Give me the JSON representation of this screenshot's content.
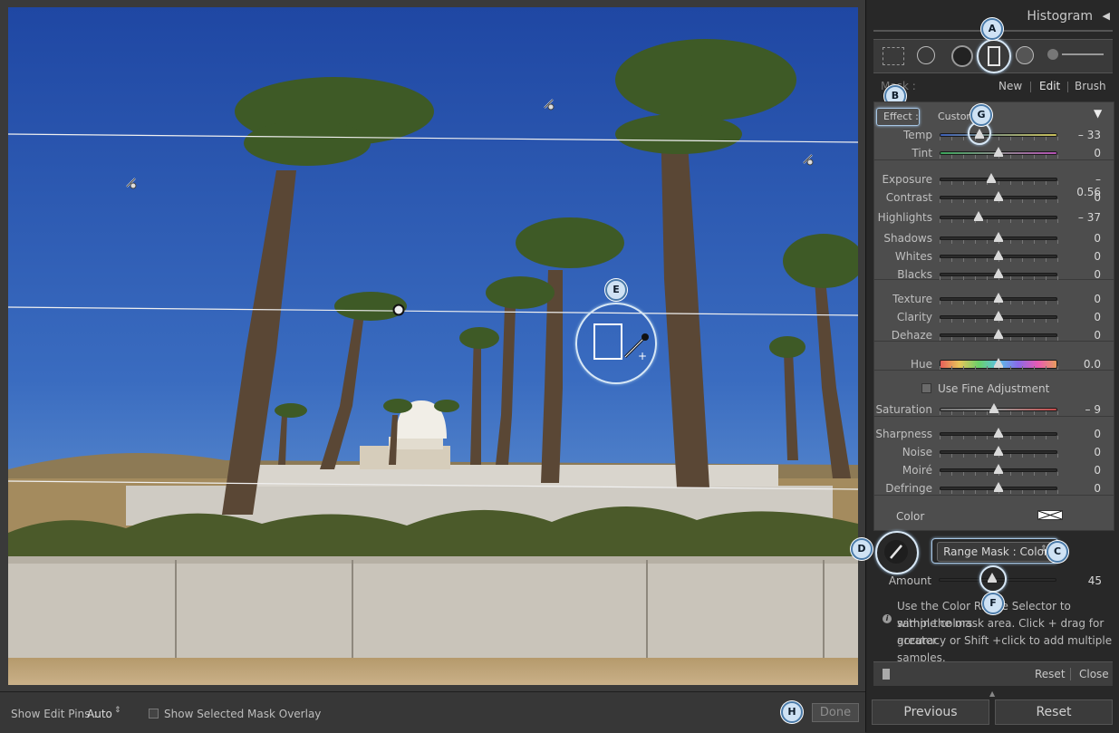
{
  "photo": {
    "pins_count_visible": 3,
    "color_range_sampler_cursor": "eyedropper-plus-icon"
  },
  "bottom_bar": {
    "show_edit_pins_label": "Show Edit Pins :",
    "show_edit_pins_value": "Auto",
    "show_overlay_label": "Show Selected Mask Overlay",
    "done_label": "Done"
  },
  "panel": {
    "histogram_title": "Histogram",
    "mask_label": "Mask :",
    "mask_options": [
      "New",
      "Edit",
      "Brush"
    ],
    "effect_label": "Effect :",
    "effect_value": "Custom",
    "rows": [
      {
        "label": "Temp",
        "value": "– 33",
        "pos": 0.34
      },
      {
        "label": "Tint",
        "value": "0",
        "pos": 0.5
      },
      {
        "label": "Exposure",
        "value": "– 0.56",
        "pos": 0.44
      },
      {
        "label": "Contrast",
        "value": "0",
        "pos": 0.5
      },
      {
        "label": "Highlights",
        "value": "– 37",
        "pos": 0.33
      },
      {
        "label": "Shadows",
        "value": "0",
        "pos": 0.5
      },
      {
        "label": "Whites",
        "value": "0",
        "pos": 0.5
      },
      {
        "label": "Blacks",
        "value": "0",
        "pos": 0.5
      },
      {
        "label": "Texture",
        "value": "0",
        "pos": 0.5
      },
      {
        "label": "Clarity",
        "value": "0",
        "pos": 0.5
      },
      {
        "label": "Dehaze",
        "value": "0",
        "pos": 0.5
      },
      {
        "label": "Hue",
        "value": "0.0",
        "pos": 0.5
      },
      {
        "label": "Saturation",
        "value": "– 9",
        "pos": 0.46
      },
      {
        "label": "Sharpness",
        "value": "0",
        "pos": 0.5
      },
      {
        "label": "Noise",
        "value": "0",
        "pos": 0.5
      },
      {
        "label": "Moiré",
        "value": "0",
        "pos": 0.5
      },
      {
        "label": "Defringe",
        "value": "0",
        "pos": 0.5
      }
    ],
    "fine_adjust_label": "Use Fine Adjustment",
    "color_label": "Color",
    "range_mask_label": "Range Mask : Color",
    "amount_label": "Amount",
    "amount_value": "45",
    "amount_pos": 0.45,
    "help_lines": [
      "Use the Color Range Selector to sample colors",
      "within the mask area. Click + drag for greater",
      "accuracy or Shift +click to add multiple samples."
    ],
    "reset_label": "Reset",
    "close_label": "Close",
    "previous_label": "Previous",
    "reset_button_label": "Reset"
  },
  "callouts": {
    "a": "A",
    "b": "B",
    "c": "C",
    "d": "D",
    "e": "E",
    "f": "F",
    "g": "G",
    "h": "H"
  },
  "colors": {
    "sky_top": "#1f47a3",
    "sky_bottom": "#5d93d4",
    "callout_fill": "#cfe2f4",
    "callout_border": "#4a7aa8",
    "panel_bg": "#4d4d4d"
  }
}
